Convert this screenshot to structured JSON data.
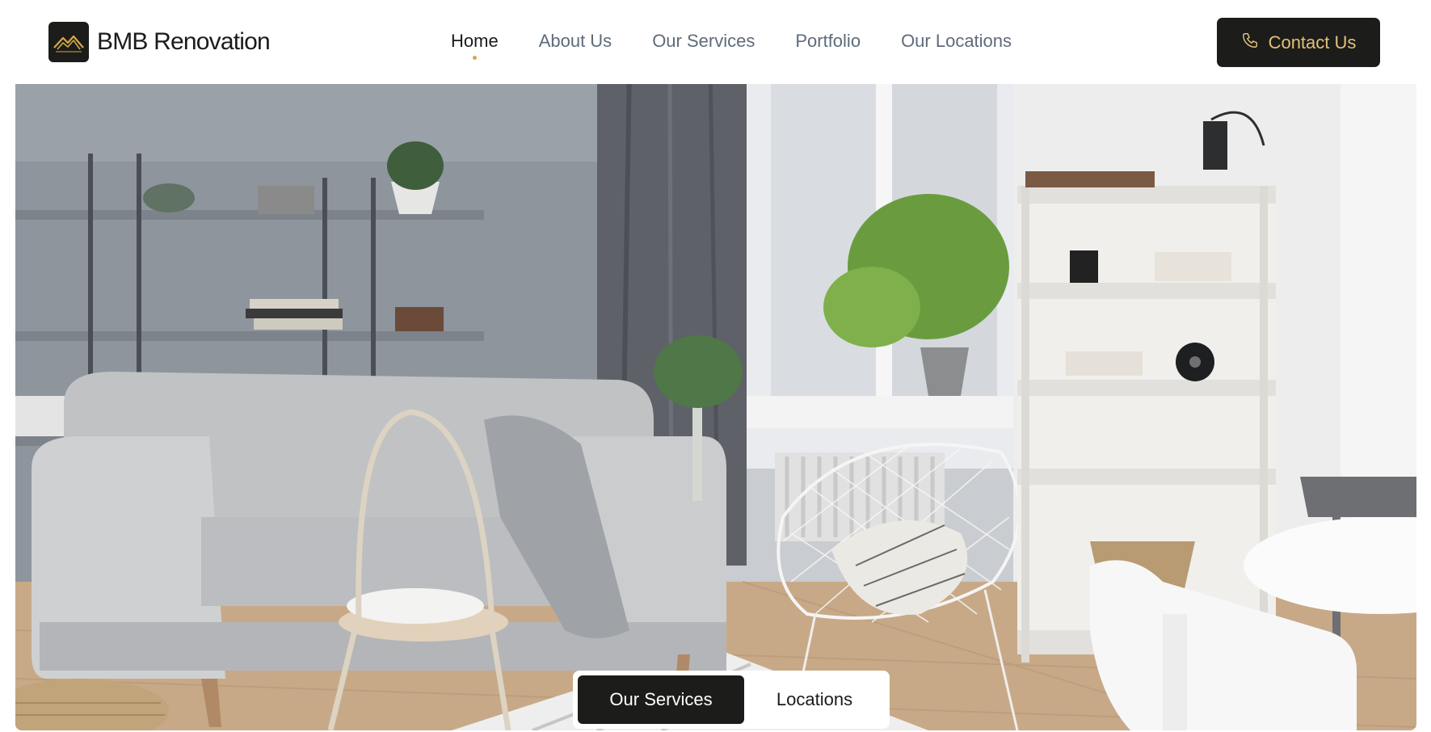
{
  "brand": {
    "name": "BMB Renovation",
    "logo_icon": "roof-mountain-icon",
    "accent": "#d4a94a"
  },
  "nav": {
    "items": [
      {
        "label": "Home",
        "active": true
      },
      {
        "label": "About Us",
        "active": false
      },
      {
        "label": "Our Services",
        "active": false
      },
      {
        "label": "Portfolio",
        "active": false
      },
      {
        "label": "Our Locations",
        "active": false
      }
    ]
  },
  "contact": {
    "label": "Contact Us",
    "icon": "phone-icon",
    "text_color": "#e3c07a"
  },
  "hero": {
    "tabs": [
      {
        "label": "Our Services",
        "active": true
      },
      {
        "label": "Locations",
        "active": false
      }
    ]
  },
  "colors": {
    "dark": "#1c1c1a",
    "nav_inactive": "#5f6b7a",
    "white": "#ffffff"
  }
}
